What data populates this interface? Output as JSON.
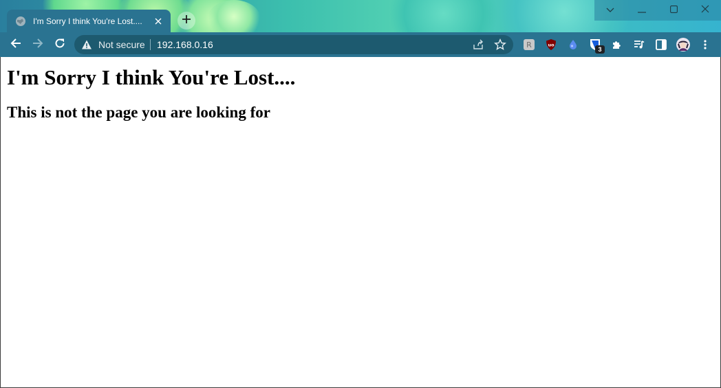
{
  "browser": {
    "tab": {
      "title": "I'm Sorry I think You're Lost....",
      "favicon": "globe-icon",
      "close_icon": "close-icon"
    },
    "new_tab_icon": "plus-icon",
    "window_controls": [
      "tab-search-icon",
      "minimize-icon",
      "maximize-icon",
      "close-icon"
    ],
    "toolbar": {
      "back_icon": "arrow-left-icon",
      "forward_icon": "arrow-right-icon",
      "reload_icon": "reload-icon"
    },
    "omnibox": {
      "security_label": "Not secure",
      "url": "192.168.0.16",
      "share_icon": "share-icon",
      "bookmark_icon": "star-icon"
    },
    "extensions": {
      "icons": [
        "extension-grey-icon",
        "ublock-icon",
        "drop-icon",
        "bitwarden-icon",
        "puzzle-icon",
        "media-queue-icon",
        "side-panel-icon",
        "profile-avatar",
        "kebab-menu-icon"
      ],
      "bitwarden_badge": "3"
    },
    "colors": {
      "chrome_teal": "#2a7391",
      "omnibox_bg": "#1d5a6f",
      "ublock_red": "#800000",
      "bitwarden_blue": "#175ddc"
    }
  },
  "page": {
    "heading": "I'm Sorry I think You're Lost....",
    "subheading": "This is not the page you are looking for"
  }
}
